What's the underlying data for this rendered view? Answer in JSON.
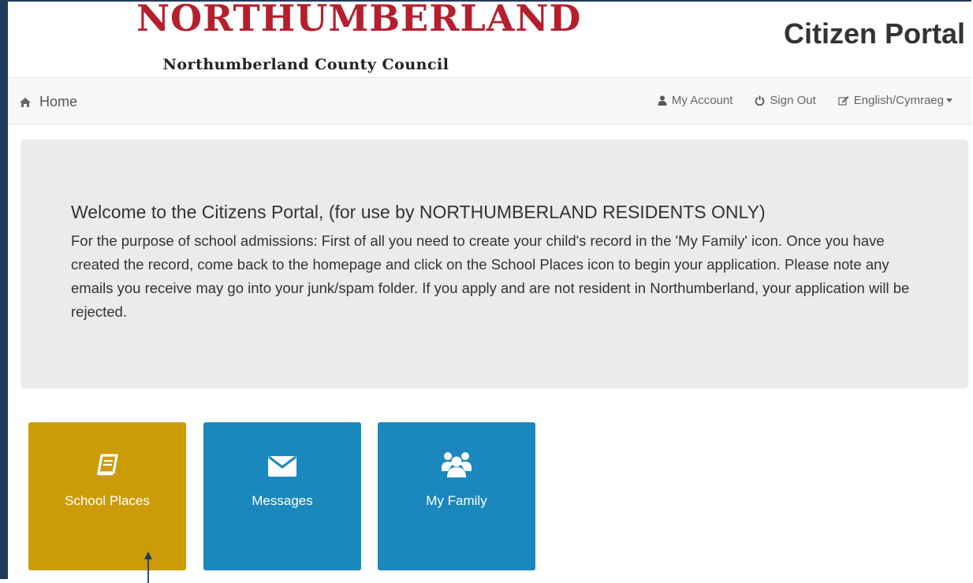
{
  "header": {
    "brand_word": "NORTHUMBERLAND",
    "brand_sub": "Northumberland County Council",
    "portal_title": "Citizen Portal",
    "brand_color": "#b51f2d"
  },
  "navbar": {
    "home_label": "Home",
    "home_icon": "home-icon",
    "my_account_label": "My Account",
    "sign_out_label": "Sign Out",
    "language_label": "English/Cymraeg"
  },
  "welcome": {
    "heading": "Welcome to the Citizens Portal, (for use by NORTHUMBERLAND RESIDENTS ONLY)",
    "body": "For the purpose of school admissions: First of all you need to create your child's record in the 'My Family' icon. Once you have created the record, come back to the homepage and click on the School Places icon to begin your application. Please note any emails you receive may go into your junk/spam folder. If you apply and are not resident in Northumberland, your application will be rejected."
  },
  "tiles": [
    {
      "label": "School Places",
      "icon": "book-icon",
      "color": "#cc9c08"
    },
    {
      "label": "Messages",
      "icon": "envelope-icon",
      "color": "#1b88bd"
    },
    {
      "label": "My Family",
      "icon": "users-icon",
      "color": "#1b88bd"
    }
  ]
}
